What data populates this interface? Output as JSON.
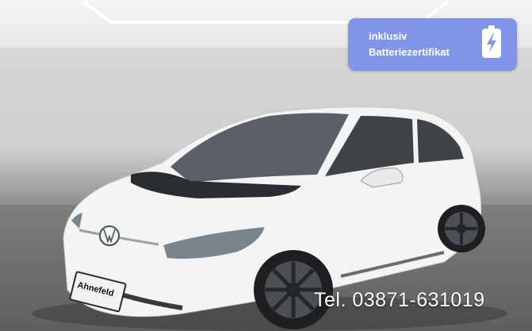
{
  "badge": {
    "line1": "inklusiv",
    "line2": "Batteriezertifikat",
    "icon": "battery-charging-icon",
    "color": "#7f95e8"
  },
  "dealer_plate": {
    "text": "Ahnefeld"
  },
  "phone_overlay": {
    "text": "Tel. 03871-631019"
  }
}
